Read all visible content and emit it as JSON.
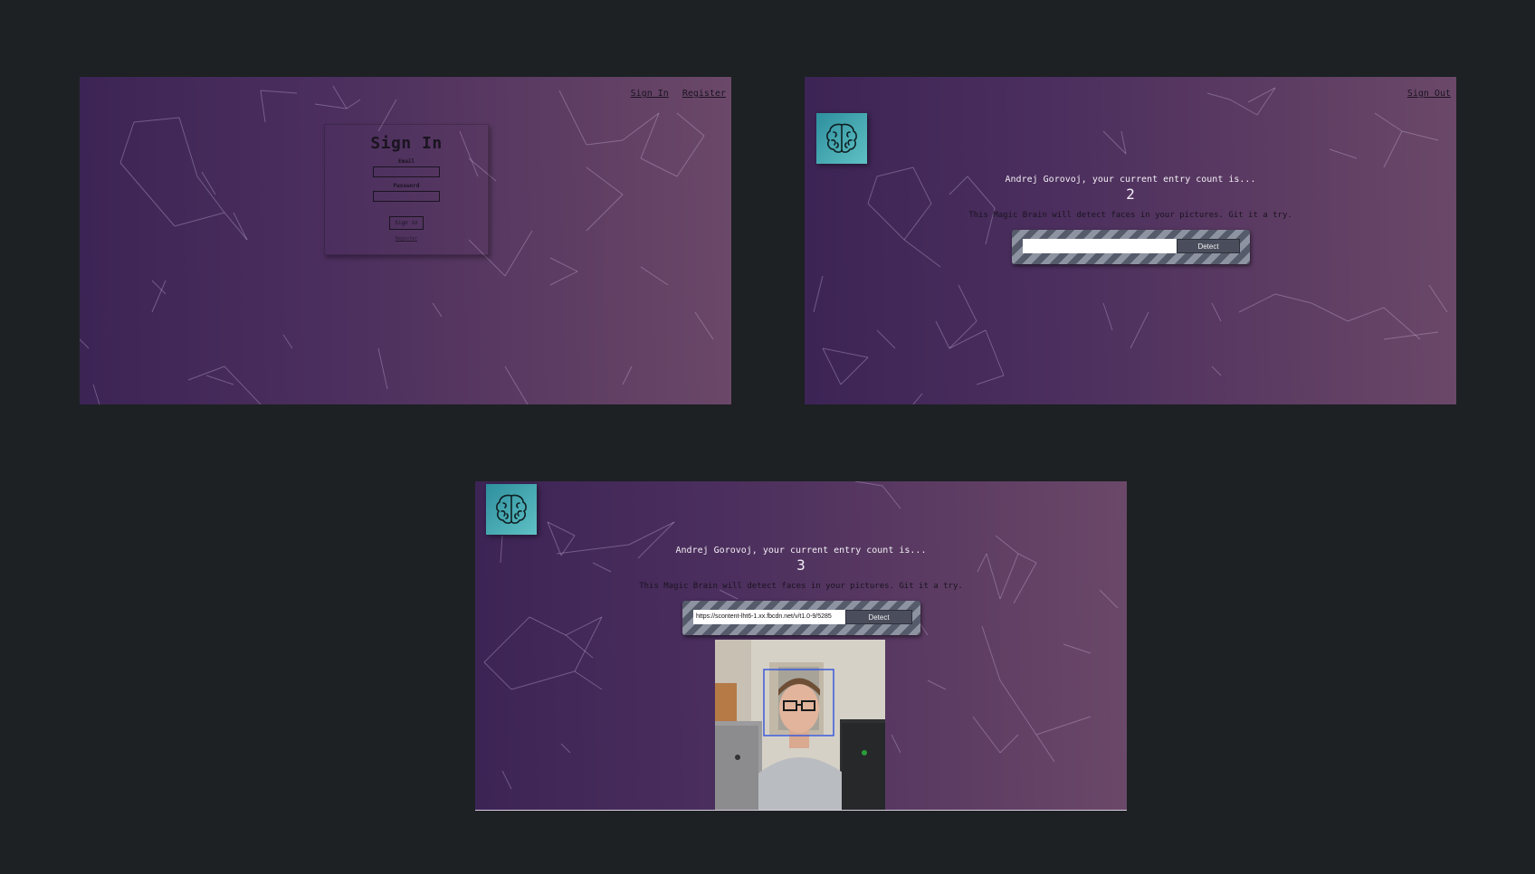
{
  "colors": {
    "page_bg": "#1d2124",
    "gradient_start": "#3c2455",
    "gradient_end": "#6b4869",
    "logo_teal": "#4fb3ba",
    "face_box": "#3b5bdb"
  },
  "panel_signin": {
    "nav": {
      "signin_label": "Sign In",
      "register_label": "Register"
    },
    "card": {
      "title": "Sign In",
      "email_label": "Email",
      "password_label": "Password",
      "button_label": "Sign in",
      "register_link": "Register"
    }
  },
  "panel_home": {
    "nav": {
      "signout_label": "Sign Out"
    },
    "logo_icon": "brain-icon",
    "greeting": "Andrej Gorovoj, your current entry count is...",
    "count": "2",
    "description": "This Magic Brain will detect faces in your pictures. Git it a try.",
    "url_value": "",
    "detect_label": "Detect"
  },
  "panel_result": {
    "logo_icon": "brain-icon",
    "greeting": "Andrej Gorovoj, your current entry count is...",
    "count": "3",
    "description": "This Magic Brain will detect faces in your pictures. Git it a try.",
    "url_value": "https://scontent-lht6-1.xx.fbcdn.net/v/t1.0-9/5285",
    "detect_label": "Detect",
    "image_alt": "photo of a person holding two laptops with detected face box"
  }
}
